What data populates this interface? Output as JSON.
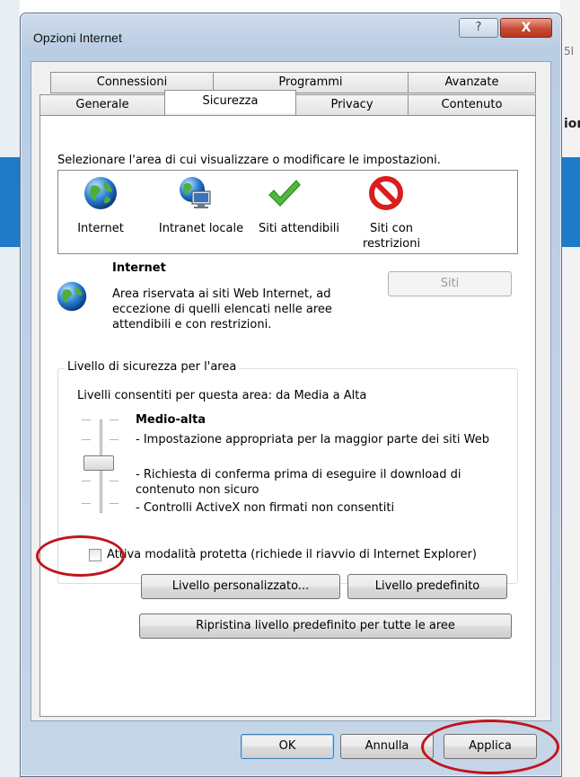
{
  "window": {
    "title": "Opzioni Internet",
    "help_glyph": "?",
    "close_glyph": "X"
  },
  "background": {
    "right_text": "5I",
    "right_bold": "ior"
  },
  "tabs_row1": [
    "Connessioni",
    "Programmi",
    "Avanzate"
  ],
  "tabs_row2": [
    "Generale",
    "Sicurezza",
    "Privacy",
    "Contenuto"
  ],
  "active_tab": "Sicurezza",
  "security": {
    "instruction": "Selezionare l'area di cui visualizzare o modificare le impostazioni.",
    "zones": [
      {
        "label": "Internet",
        "icon": "globe-icon"
      },
      {
        "label": "Intranet locale",
        "icon": "intranet-icon"
      },
      {
        "label": "Siti attendibili",
        "icon": "checkmark-icon"
      },
      {
        "label": "Siti con restrizioni",
        "icon": "restricted-icon"
      }
    ],
    "selected_zone_title": "Internet",
    "selected_zone_desc": "Area riservata ai siti Web Internet, ad eccezione di quelli elencati nelle aree attendibili e con restrizioni.",
    "sites_button": "Siti",
    "group_title": "Livello di sicurezza per l'area",
    "allowed_levels": "Livelli consentiti per questa area: da Media a Alta",
    "level_name": "Medio-alta",
    "level_desc": [
      "- Impostazione appropriata per la maggior parte dei siti Web",
      "- Richiesta di conferma prima di eseguire il download di contenuto non sicuro",
      "- Controlli ActiveX non firmati non consentiti"
    ],
    "protected_mode_label": "Attiva modalità protetta (richiede il riavvio di Internet Explorer)",
    "protected_mode_checked": false,
    "custom_level_button": "Livello personalizzato...",
    "default_level_button": "Livello predefinito",
    "reset_all_button": "Ripristina livello predefinito per tutte le aree"
  },
  "footer": {
    "ok": "OK",
    "cancel": "Annulla",
    "apply": "Applica"
  },
  "colors": {
    "annotation": "#c0141b",
    "titlebar": "#b9cde3",
    "close_button": "#c84a33"
  }
}
